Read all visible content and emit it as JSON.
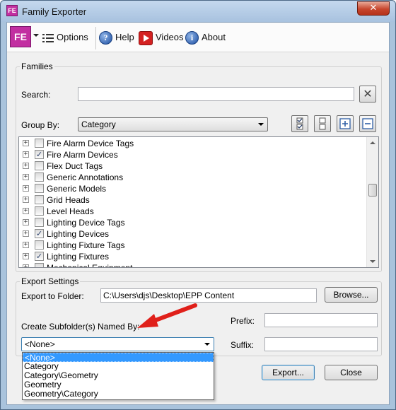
{
  "window": {
    "title": "Family Exporter",
    "close_glyph": "✕"
  },
  "toolbar": {
    "logo_text": "FE",
    "options_label": "Options",
    "help_label": "Help",
    "videos_label": "Videos",
    "about_label": "About"
  },
  "families": {
    "group_label": "Families",
    "search_label": "Search:",
    "search_value": "",
    "group_by_label": "Group By:",
    "group_by_value": "Category",
    "items": [
      {
        "label": "Fire Alarm Device Tags",
        "checked": false
      },
      {
        "label": "Fire Alarm Devices",
        "checked": true
      },
      {
        "label": "Flex Duct Tags",
        "checked": false
      },
      {
        "label": "Generic Annotations",
        "checked": false
      },
      {
        "label": "Generic Models",
        "checked": false
      },
      {
        "label": "Grid Heads",
        "checked": false
      },
      {
        "label": "Level Heads",
        "checked": false
      },
      {
        "label": "Lighting Device Tags",
        "checked": false
      },
      {
        "label": "Lighting Devices",
        "checked": true
      },
      {
        "label": "Lighting Fixture Tags",
        "checked": false
      },
      {
        "label": "Lighting Fixtures",
        "checked": true
      },
      {
        "label": "Mechanical Equipment",
        "checked": false
      }
    ]
  },
  "export": {
    "group_label": "Export Settings",
    "folder_label": "Export to Folder:",
    "folder_value": "C:\\Users\\djs\\Desktop\\EPP Content",
    "browse_label": "Browse...",
    "subfolder_label": "Create Subfolder(s) Named By:",
    "subfolder_value": "<None>",
    "subfolder_options": [
      "<None>",
      "Category",
      "Category\\Geometry",
      "Geometry",
      "Geometry\\Category"
    ],
    "prefix_label": "Prefix:",
    "prefix_value": "",
    "suffix_label": "Suffix:",
    "suffix_value": ""
  },
  "actions": {
    "export_label": "Export...",
    "close_label": "Close"
  },
  "colors": {
    "annotation_arrow": "#e0201a",
    "selection": "#3399ff",
    "logo": "#c22fa1"
  }
}
